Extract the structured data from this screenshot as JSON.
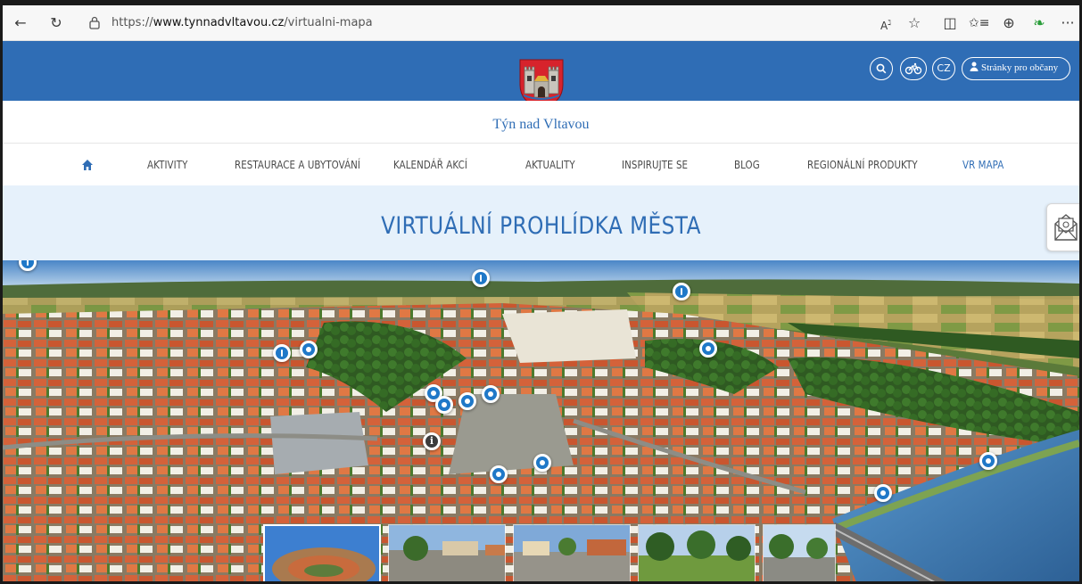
{
  "browser": {
    "url_prefix": "https://",
    "url_domain": "www.tynnadvltavou.cz",
    "url_path": "/virtualni-mapa",
    "icons": [
      "back-icon",
      "refresh-icon",
      "lock-icon",
      "read-aloud-icon",
      "favorite-icon",
      "split-screen-icon",
      "favorites-icon",
      "collections-icon",
      "extensions-icon",
      "more-icon"
    ]
  },
  "header": {
    "site_name": "Týn nad Vltavou",
    "lang": "CZ",
    "citizens_button": "Stránky pro občany",
    "brand_color": "#2f6db5"
  },
  "nav": {
    "items": [
      {
        "label": "AKTIVITY",
        "active": false
      },
      {
        "label": "RESTAURACE A UBYTOVÁNÍ",
        "active": false
      },
      {
        "label": "KALENDÁŘ AKCÍ",
        "active": false
      },
      {
        "label": "AKTUALITY",
        "active": false
      },
      {
        "label": "INSPIRUJTE SE",
        "active": false
      },
      {
        "label": "BLOG",
        "active": false
      },
      {
        "label": "REGIONÁLNÍ PRODUKTY",
        "active": false
      },
      {
        "label": "VR MAPA",
        "active": true
      }
    ]
  },
  "main": {
    "title": "VIRTUÁLNÍ PROHLÍDKA MĚSTA"
  },
  "panorama": {
    "hotspot_count": 14,
    "thumbnail_count": 5
  }
}
